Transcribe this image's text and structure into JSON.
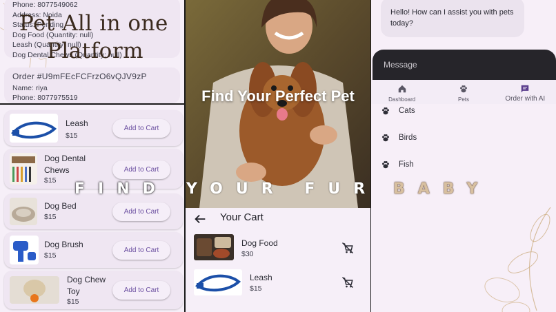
{
  "promo": {
    "title_line1": "Pet All in one",
    "title_line2": "Platform"
  },
  "orders": [
    {
      "lines": [
        "Phone: 8077549062",
        "Address: Noida",
        "Status: Pending",
        "Dog Food (Quantity: null)",
        "Leash (Quantity: null)",
        "Dog Dental Chews (Quantity: null)"
      ]
    },
    {
      "id": "Order #U9mFEcFCFrzO6vQJV9zP",
      "name": "Name: riya",
      "phone": "Phone: 8077975519"
    }
  ],
  "products": [
    {
      "name": "Leash",
      "price": "$15",
      "button": "Add to Cart"
    },
    {
      "name": "Dog Dental Chews",
      "price": "$15",
      "button": "Add to Cart"
    },
    {
      "name": "Dog Bed",
      "price": "$15",
      "button": "Add to Cart"
    },
    {
      "name": "Dog Brush",
      "price": "$15",
      "button": "Add to Cart"
    },
    {
      "name": "Dog Chew Toy",
      "price": "$15",
      "button": "Add to Cart"
    }
  ],
  "hero": {
    "title": "Find Your Perfect Pet"
  },
  "cart": {
    "title": "Your Cart",
    "items": [
      {
        "name": "Dog Food",
        "price": "$30"
      },
      {
        "name": "Leash",
        "price": "$15"
      }
    ]
  },
  "chat": {
    "greeting": "Hello! How can I assist you with pets today?",
    "input_placeholder": "Message"
  },
  "nav": {
    "items": [
      {
        "label": "Dashboard",
        "icon": "home-icon"
      },
      {
        "label": "Pets",
        "icon": "paw-icon"
      },
      {
        "label": "Order with AI",
        "icon": "chat-icon"
      }
    ]
  },
  "pets": {
    "categories": [
      {
        "label": "Cats",
        "icon": "paw-icon"
      },
      {
        "label": "Birds",
        "icon": "paw-icon"
      },
      {
        "label": "Fish",
        "icon": "paw-icon"
      }
    ]
  },
  "tagline": {
    "part1": "FIND",
    "part2": "YOUR FUR",
    "part3": "BABY"
  },
  "colors": {
    "accent": "#6b4fa0",
    "card_bg": "#efe6f2",
    "page_bg": "#f6eff8",
    "chat_input_bg": "#26252a"
  }
}
